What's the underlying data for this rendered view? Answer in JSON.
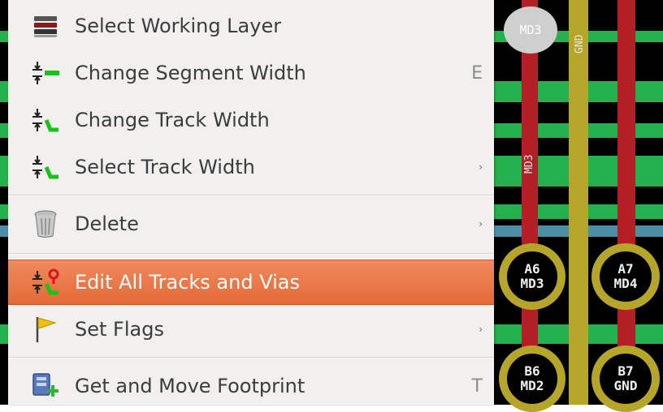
{
  "menu": {
    "items": [
      {
        "label": "Select Working Layer",
        "shortcut": "",
        "submenu": false,
        "icon": "layers-icon"
      },
      {
        "label": "Change Segment Width",
        "shortcut": "E",
        "submenu": false,
        "icon": "segment-width-icon"
      },
      {
        "label": "Change Track Width",
        "shortcut": "",
        "submenu": false,
        "icon": "track-width-icon"
      },
      {
        "label": "Select Track Width",
        "shortcut": "",
        "submenu": true,
        "icon": "track-width-icon"
      },
      {
        "label": "Delete",
        "shortcut": "",
        "submenu": true,
        "icon": "trash-can-icon"
      },
      {
        "label": "Edit All Tracks and Vias",
        "shortcut": "",
        "submenu": false,
        "icon": "edit-tracks-vias-icon",
        "highlighted": true
      },
      {
        "label": "Set Flags",
        "shortcut": "",
        "submenu": true,
        "icon": "flag-icon"
      },
      {
        "label": "Get and Move Footprint",
        "shortcut": "T",
        "submenu": false,
        "icon": "move-footprint-icon"
      }
    ],
    "submenu_glyph": "›",
    "highlight_color": "#e8743f"
  },
  "pcb": {
    "pad_labels": [
      {
        "pin": "A6",
        "net": "MD3"
      },
      {
        "pin": "A7",
        "net": "MD4"
      },
      {
        "pin": "B6",
        "net": "MD2"
      },
      {
        "pin": "B7",
        "net": "GND"
      }
    ],
    "hole_label": "MD3",
    "track_labels": [
      "GND",
      "MD3"
    ],
    "colors": {
      "copper_front": "#22b14c",
      "copper_back": "#c0141b",
      "track_yellow": "#b5a62a"
    }
  }
}
